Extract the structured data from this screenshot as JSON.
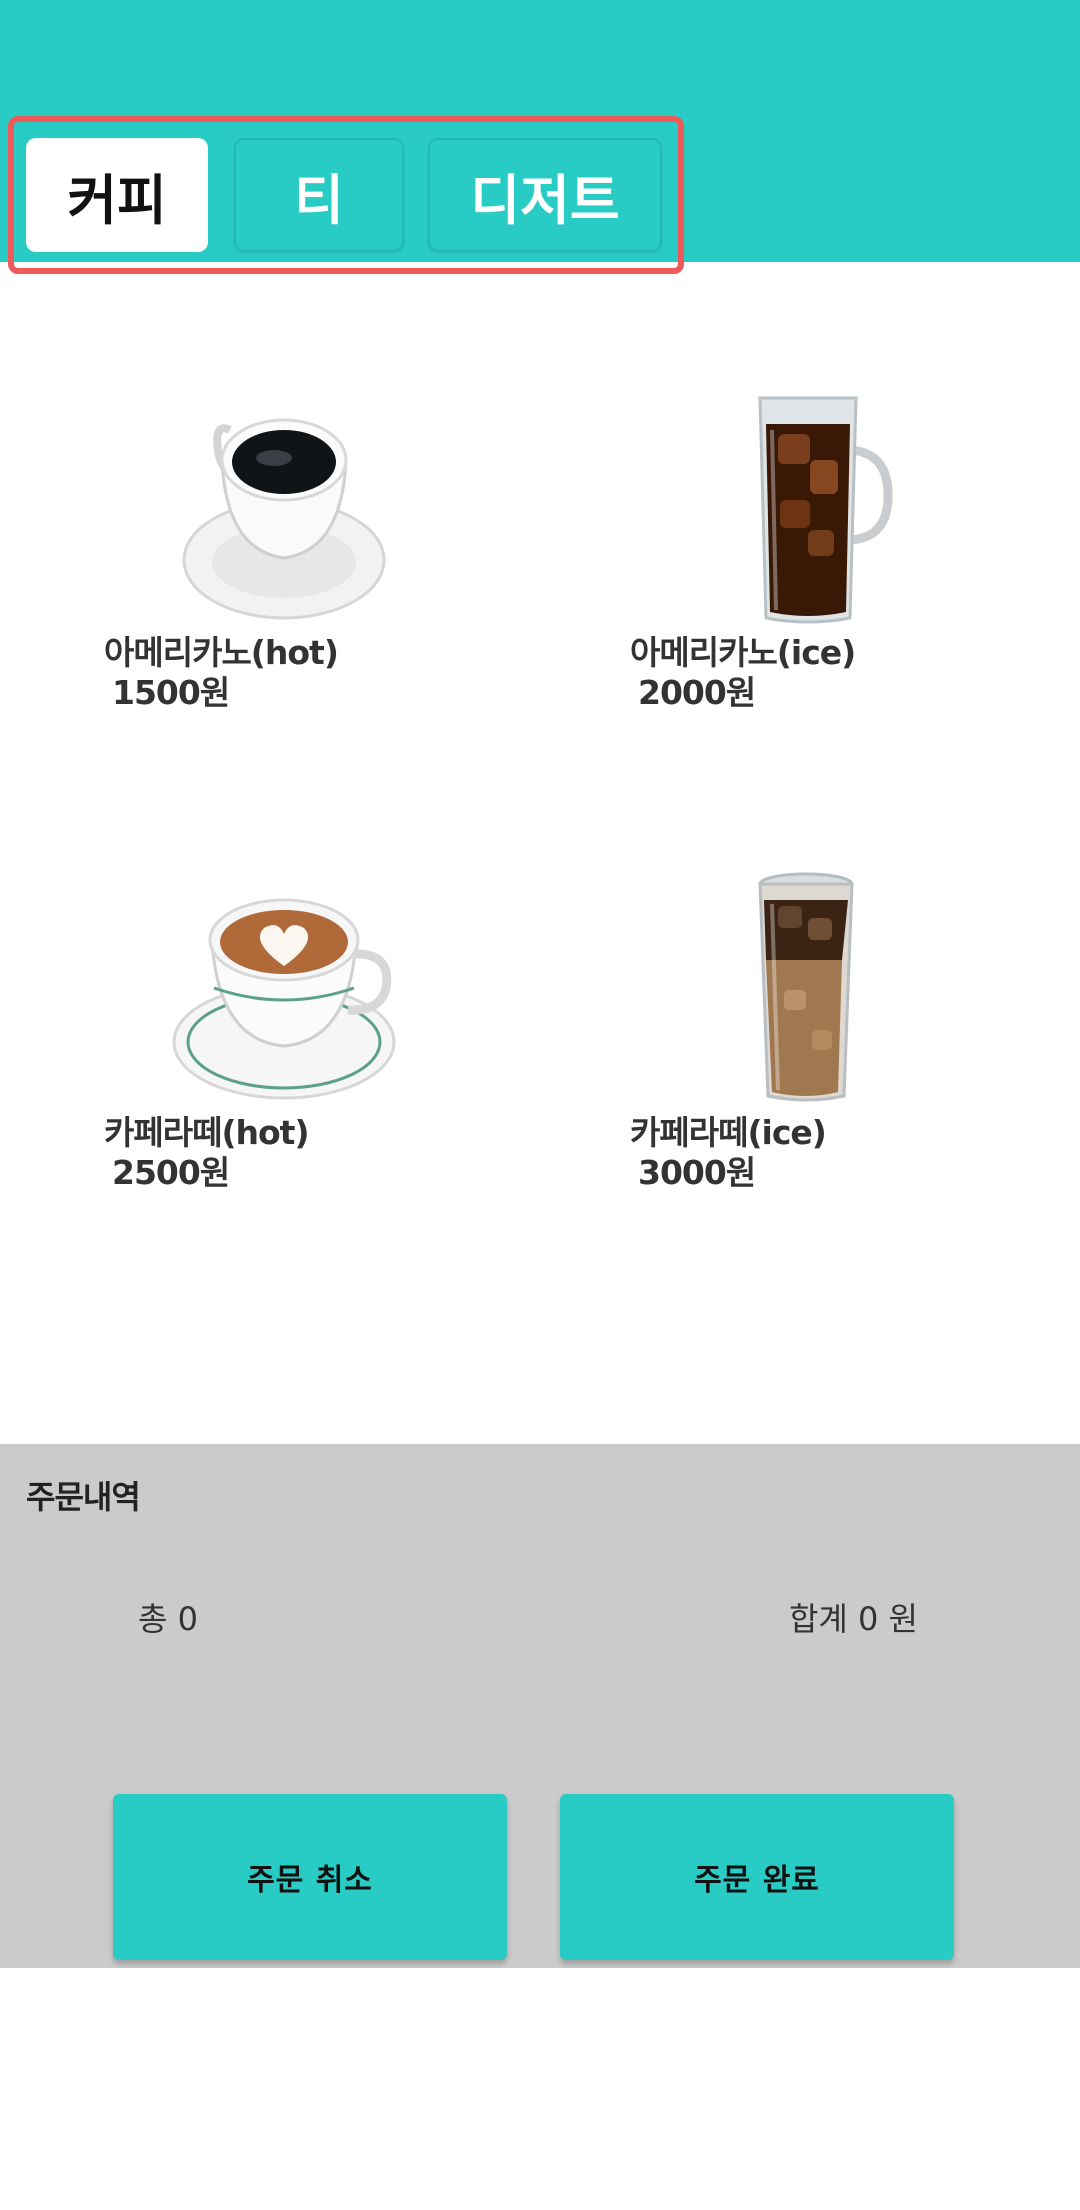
{
  "tabs": [
    {
      "label": "커피",
      "active": true
    },
    {
      "label": "티",
      "active": false
    },
    {
      "label": "디저트",
      "active": false
    }
  ],
  "menu": [
    {
      "name": "아메리카노(hot)",
      "price": "1500원",
      "image": "hot-americano-cup"
    },
    {
      "name": "아메리카노(ice)",
      "price": "2000원",
      "image": "iced-americano-glass"
    },
    {
      "name": "카페라떼(hot)",
      "price": "2500원",
      "image": "hot-latte-cup"
    },
    {
      "name": "카페라떼(ice)",
      "price": "3000원",
      "image": "iced-latte-glass"
    }
  ],
  "order": {
    "title": "주문내역",
    "count": "총 0",
    "total": "합계 0 원",
    "cancel_label": "주문 취소",
    "complete_label": "주문 완료"
  },
  "colors": {
    "accent": "#29CCC4",
    "panel": "#CBCBCB",
    "highlight": "#EE5A5A"
  }
}
